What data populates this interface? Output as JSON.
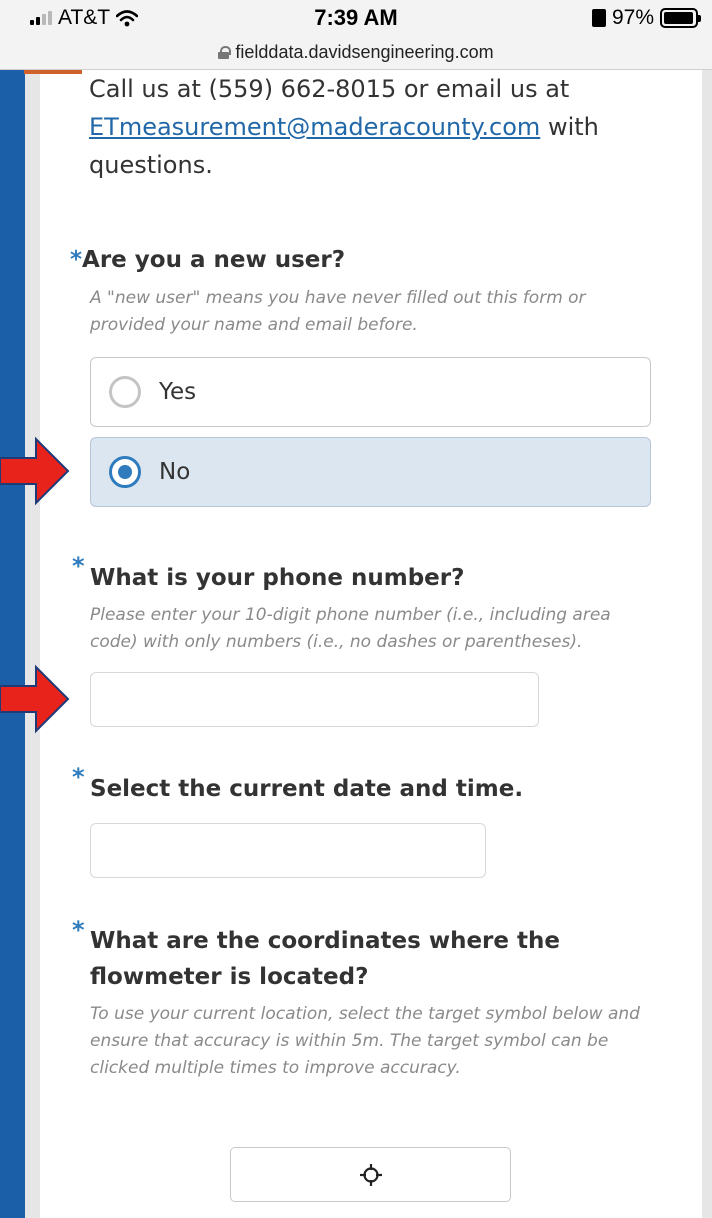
{
  "status_bar": {
    "carrier": "AT&T",
    "time": "7:39 AM",
    "battery": "97%",
    "battery_level": 0.97
  },
  "browser": {
    "url": "fielddata.davidsengineering.com"
  },
  "intro": {
    "text_before": "Call us at (559) 662-8015 or email us at ",
    "email": "ETmeasurement@maderacounty.com",
    "text_after": " with questions."
  },
  "questions": {
    "new_user": {
      "required_mark": "*",
      "title": "Are you a new user?",
      "help": "A \"new user\" means you have never filled out this form or provided your name and email before.",
      "options": [
        {
          "label": "Yes",
          "selected": false
        },
        {
          "label": "No",
          "selected": true
        }
      ]
    },
    "phone": {
      "required_mark": "*",
      "title": "What is your phone number?",
      "help": "Please enter your 10-digit phone number (i.e., including area code) with only numbers (i.e., no dashes or parentheses).",
      "value": ""
    },
    "datetime": {
      "required_mark": "*",
      "title": "Select the current date and time.",
      "value": ""
    },
    "coordinates": {
      "required_mark": "*",
      "title": "What are the coordinates where the flowmeter is located?",
      "help": "To use your current location, select the target symbol below and ensure that accuracy is within 5m. The target symbol can be clicked multiple times to improve accuracy.",
      "button_icon": "crosshair-target-icon"
    }
  },
  "colors": {
    "accent": "#2e7bbd",
    "selected_bg": "#dce6f1",
    "arrow": "#e8231c",
    "brand_blue": "#1a5fa8",
    "orange": "#d0612b"
  }
}
